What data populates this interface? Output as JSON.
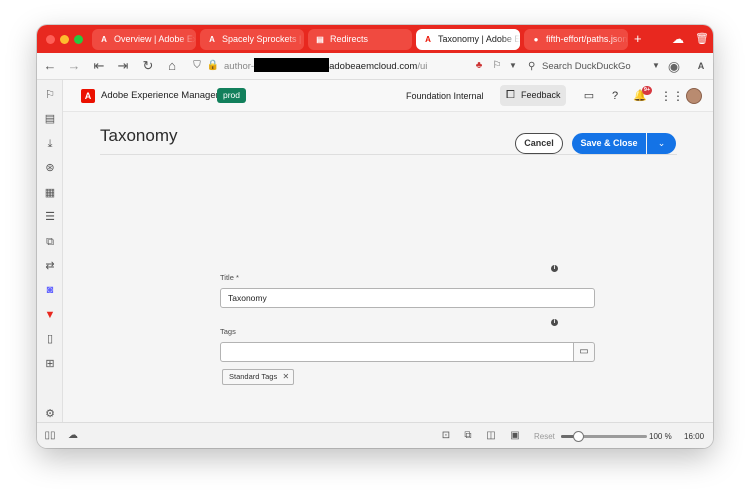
{
  "browser": {
    "tabs": [
      {
        "label": "Overview | Adobe Experience",
        "icon": "adobe-icon"
      },
      {
        "label": "Spacely Sprockets | AEM",
        "icon": "adobe-icon"
      },
      {
        "label": "Redirects",
        "icon": "document-icon"
      },
      {
        "label": "Taxonomy | Adobe Experience",
        "icon": "adobe-icon",
        "active": true
      },
      {
        "label": "fifth-effort/paths.json",
        "icon": "github-icon"
      }
    ],
    "url_prefix": "author-",
    "url_domain": "adobeaemcloud.com",
    "url_path": "/ui",
    "search_placeholder": "Search DuckDuckGo",
    "translate_label": "A"
  },
  "header": {
    "logo_letter": "A",
    "app_title": "Adobe Experience Manager",
    "env_badge": "prod",
    "org_name": "Foundation Internal",
    "feedback_label": "Feedback",
    "notification_count": "9+"
  },
  "page": {
    "title": "Taxonomy",
    "cancel_label": "Cancel",
    "save_label": "Save & Close"
  },
  "form": {
    "title_label": "Title *",
    "title_value": "Taxonomy",
    "tags_label": "Tags",
    "tags_value": "",
    "tag_chip": "Standard Tags",
    "info_glyph": "i"
  },
  "statusbar": {
    "reset_label": "Reset",
    "zoom_percent": 100,
    "zoom_label": "100 %",
    "time": "16:00",
    "zoom_fraction": 0.2
  },
  "colors": {
    "tabbar": "#e8281f",
    "primary_button": "#1473e6",
    "env_badge": "#12805c",
    "adobe_red": "#eb1000"
  }
}
